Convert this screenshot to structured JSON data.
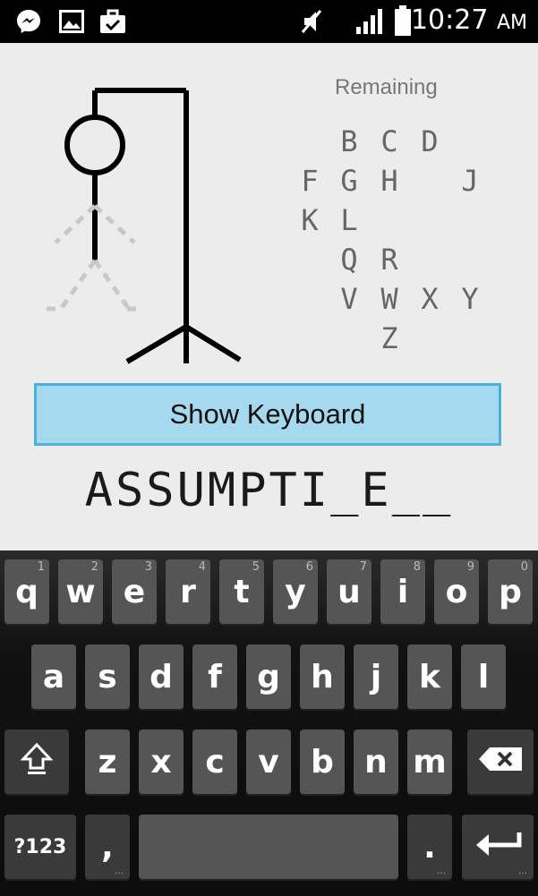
{
  "status_bar": {
    "time": "10:27",
    "ampm": "AM",
    "icons": [
      "messenger-icon",
      "image-icon",
      "briefcase-check-icon",
      "mute-icon",
      "signal-icon",
      "battery-icon"
    ]
  },
  "game": {
    "remaining_title": "Remaining",
    "remaining_letters": [
      "B",
      "C",
      "D",
      "F",
      "G",
      "H",
      "J",
      "K",
      "L",
      "Q",
      "R",
      "V",
      "W",
      "X",
      "Y",
      "Z"
    ],
    "show_keyboard_label": "Show Keyboard",
    "word": "ASSUMPTI_E__"
  },
  "keyboard": {
    "row1": [
      {
        "label": "q",
        "hint": "1"
      },
      {
        "label": "w",
        "hint": "2"
      },
      {
        "label": "e",
        "hint": "3"
      },
      {
        "label": "r",
        "hint": "4"
      },
      {
        "label": "t",
        "hint": "5"
      },
      {
        "label": "y",
        "hint": "6"
      },
      {
        "label": "u",
        "hint": "7"
      },
      {
        "label": "i",
        "hint": "8"
      },
      {
        "label": "o",
        "hint": "9"
      },
      {
        "label": "p",
        "hint": "0"
      }
    ],
    "row2": [
      "a",
      "s",
      "d",
      "f",
      "g",
      "h",
      "j",
      "k",
      "l"
    ],
    "row3": [
      "z",
      "x",
      "c",
      "v",
      "b",
      "n",
      "m"
    ],
    "symbols_label": "?123",
    "comma_label": ",",
    "period_label": ".",
    "shift_icon": "shift-icon",
    "backspace_icon": "backspace-icon",
    "enter_icon": "enter-icon"
  }
}
